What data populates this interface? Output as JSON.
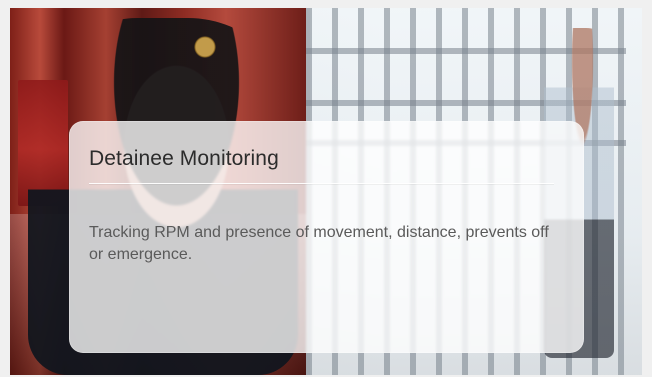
{
  "card": {
    "title": "Detainee Monitoring",
    "body": "Tracking RPM and presence of movement, distance, prevents off or emergence."
  },
  "colors": {
    "background": "#f0f0f0",
    "card_bg": "rgba(255,255,255,0.78)",
    "title": "#2c2c2c",
    "body": "#5a5a5a"
  }
}
